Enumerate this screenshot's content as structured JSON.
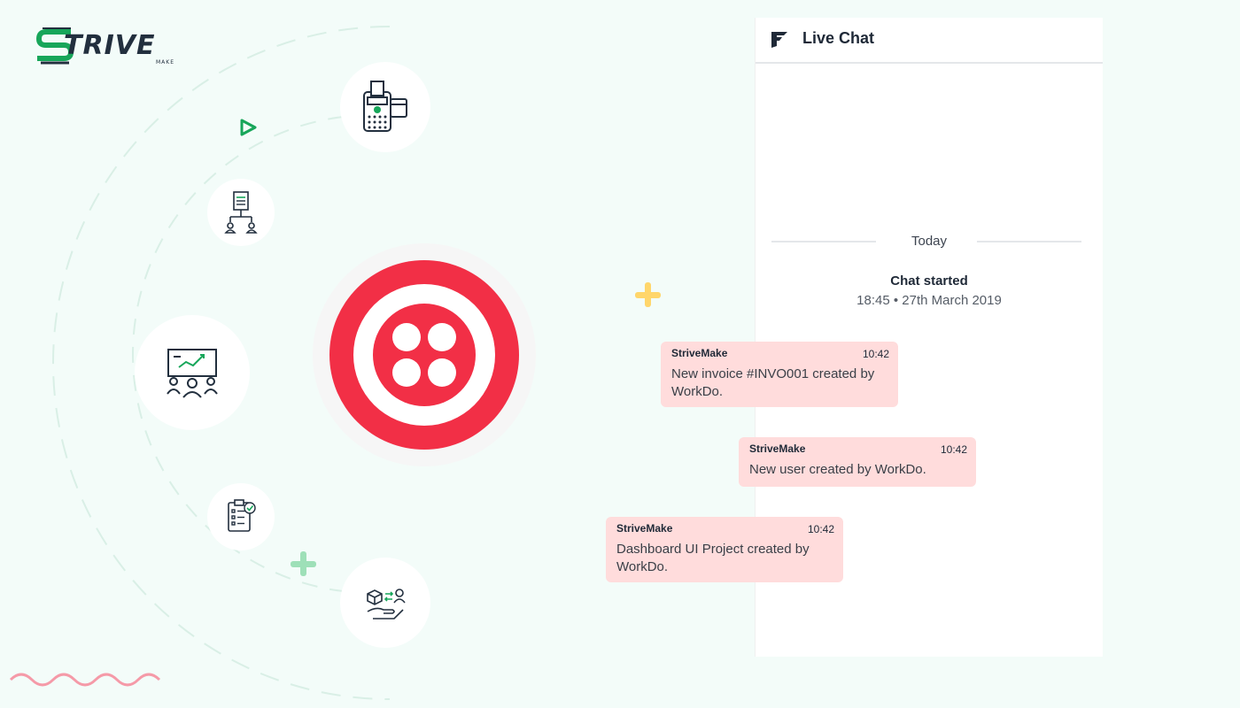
{
  "brand": {
    "name": "TRIVE",
    "tagline": "MAKE",
    "primary": "#17a65a",
    "dark": "#222f3e"
  },
  "integration": {
    "name": "Twilio",
    "color": "#f22f46"
  },
  "icons": [
    "pos-terminal-icon",
    "hierarchy-document-icon",
    "presentation-meeting-icon",
    "task-checklist-icon",
    "delivery-handover-icon"
  ],
  "chat": {
    "title": "Live Chat",
    "day_label": "Today",
    "started_label": "Chat started",
    "started_time": "18:45 • 27th March 2019",
    "messages": [
      {
        "sender": "StriveMake",
        "time": "10:42",
        "text": "New invoice #INVO001 created by WorkDo."
      },
      {
        "sender": "StriveMake",
        "time": "10:42",
        "text": "New user created by WorkDo."
      },
      {
        "sender": "StriveMake",
        "time": "10:42",
        "text": "Dashboard UI Project created by WorkDo."
      }
    ],
    "bubble_color": "#ffdcdc"
  }
}
